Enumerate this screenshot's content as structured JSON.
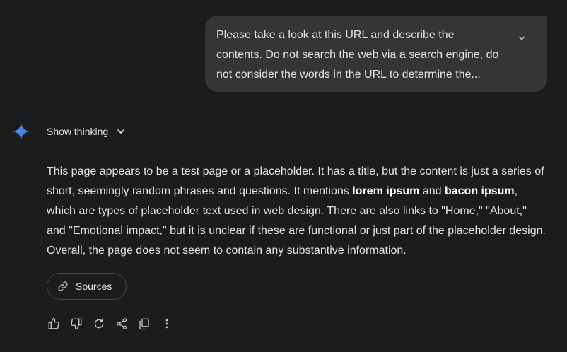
{
  "prompt": {
    "line1": "Please take a look at this URL and describe the",
    "line2": "contents. Do not search the web via a search engine, do",
    "line3": "not consider the words in the URL to determine the..."
  },
  "response": {
    "thinking_label": "Show thinking",
    "part1": "This page appears to be a test page or a placeholder. It has a title, but the content is just a series of short, seemingly random phrases and questions. It mentions ",
    "bold1": "lorem ipsum",
    "part2": " and ",
    "bold2": "bacon ipsum",
    "part3": ", which are types of placeholder text used in web design. There are also links to \"Home,\" \"About,\" and \"Emotional impact,\" but it is unclear if these are functional or just part of the placeholder design. Overall, the page does not seem to contain any substantive information.",
    "sources_label": "Sources"
  },
  "icons": {
    "expand": "chevron-down-icon",
    "spark": "gemini-spark-icon",
    "thinking": "chevron-down-icon",
    "sources": "link-icon",
    "actions": [
      "thumb-up-icon",
      "thumb-down-icon",
      "redo-icon",
      "share-icon",
      "copy-icon",
      "more-vert-icon"
    ]
  },
  "colors": {
    "background": "#1b1c1d",
    "bubble": "#333537",
    "text": "#e3e3e3",
    "spark": "#4a8af4"
  }
}
